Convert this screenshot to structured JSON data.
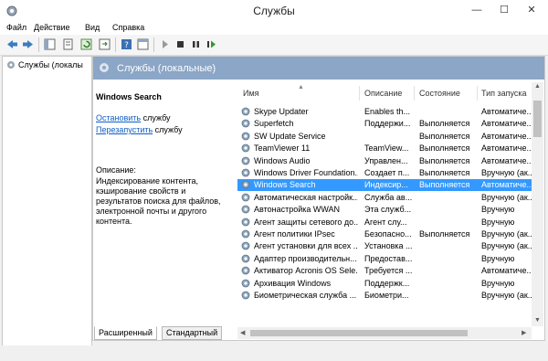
{
  "window": {
    "title": "Службы",
    "minimize": "—",
    "maximize": "☐",
    "close": "✕"
  },
  "menu": [
    "Файл",
    "Действие",
    "Вид",
    "Справка"
  ],
  "tree": {
    "item_label": "Службы (локалы"
  },
  "main": {
    "header_title": "Службы (локальные)",
    "description": {
      "service_name": "Windows Search",
      "stop_link": "Остановить",
      "stop_suffix": " службу",
      "restart_link": "Перезапустить",
      "restart_suffix": " службу",
      "desc_label": "Описание:",
      "desc_text": "Индексирование контента, кэширование свойств и результатов поиска для файлов, электронной почты и другого контента."
    },
    "columns": [
      "Имя",
      "Описание",
      "Состояние",
      "Тип запуска"
    ],
    "rows": [
      {
        "name": "Skype Updater",
        "desc": "Enables th...",
        "state": "",
        "start": "Автоматиче..."
      },
      {
        "name": "Superfetch",
        "desc": "Поддержи...",
        "state": "Выполняется",
        "start": "Автоматиче..."
      },
      {
        "name": "SW Update Service",
        "desc": "",
        "state": "Выполняется",
        "start": "Автоматиче..."
      },
      {
        "name": "TeamViewer 11",
        "desc": "TeamView...",
        "state": "Выполняется",
        "start": "Автоматиче..."
      },
      {
        "name": "Windows Audio",
        "desc": "Управлен...",
        "state": "Выполняется",
        "start": "Автоматиче..."
      },
      {
        "name": "Windows Driver Foundation...",
        "desc": "Создает п...",
        "state": "Выполняется",
        "start": "Вручную (ак..."
      },
      {
        "name": "Windows Search",
        "desc": "Индексир...",
        "state": "Выполняется",
        "start": "Автоматиче..."
      },
      {
        "name": "Автоматическая настройк...",
        "desc": "Служба ав...",
        "state": "",
        "start": "Вручную (ак..."
      },
      {
        "name": "Автонастройка WWAN",
        "desc": "Эта служб...",
        "state": "",
        "start": "Вручную"
      },
      {
        "name": "Агент защиты сетевого до...",
        "desc": "Агент слу...",
        "state": "",
        "start": "Вручную"
      },
      {
        "name": "Агент политики IPsec",
        "desc": "Безопасно...",
        "state": "Выполняется",
        "start": "Вручную (ак..."
      },
      {
        "name": "Агент установки для всех ...",
        "desc": "Установка ...",
        "state": "",
        "start": "Вручную (ак..."
      },
      {
        "name": "Адаптер производительн...",
        "desc": "Предостав...",
        "state": "",
        "start": "Вручную"
      },
      {
        "name": "Активатор Acronis OS Sele...",
        "desc": "Требуется ...",
        "state": "",
        "start": "Автоматиче..."
      },
      {
        "name": "Архивация Windows",
        "desc": "Поддержк...",
        "state": "",
        "start": "Вручную"
      },
      {
        "name": "Биометрическая служба ...",
        "desc": "Биометри...",
        "state": "",
        "start": "Вручную (ак..."
      }
    ],
    "selected_row": 6
  },
  "tabs": [
    "Расширенный",
    "Стандартный"
  ],
  "colors": {
    "selection": "#3399ff",
    "header_bg": "#8ba6c6",
    "link": "#0e5ec5"
  }
}
